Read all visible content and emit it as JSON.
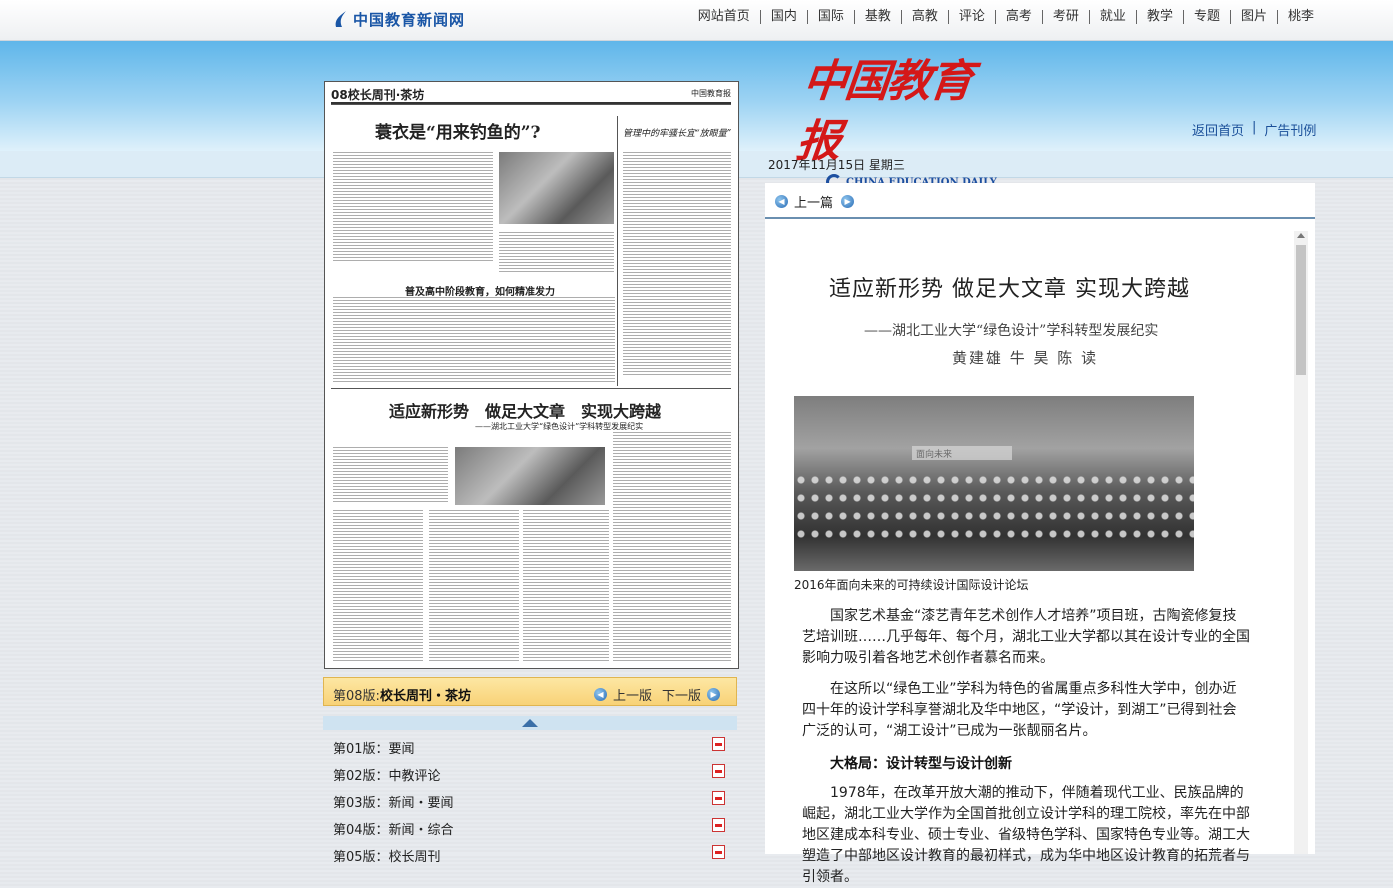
{
  "site": {
    "logo_text": "中国教育新闻网"
  },
  "top_nav": [
    "网站首页",
    "国内",
    "国际",
    "基教",
    "高教",
    "评论",
    "高考",
    "考研",
    "就业",
    "教学",
    "专题",
    "图片",
    "桃李"
  ],
  "masthead": {
    "cn": "中国教育报",
    "en": "CHINA EDUCATION DAILY"
  },
  "links": {
    "home": "返回首页",
    "sep": "|",
    "ads": "广告刊例"
  },
  "date": "2017年11月15日 星期三",
  "paper_page": {
    "header_left": "08校长周刊·茶坊",
    "header_right": "中国教育报",
    "headline_1": "蓑衣是“用来钓鱼的”?",
    "side_headline": "管理中的牢骚长宜“放眼量”",
    "mid_headline": "普及高中阶段教育，如何精准发力",
    "headline_2": "适应新形势　做足大文章　实现大跨越",
    "headline_2_sub": "——湖北工业大学“绿色设计”学科转型发展纪实"
  },
  "edition_bar": {
    "label_prefix": "第08版:",
    "label_name": "校长周刊・茶坊",
    "prev": "上一版",
    "next": "下一版"
  },
  "page_list": [
    {
      "label": "第01版：要闻"
    },
    {
      "label": "第02版：中教评论"
    },
    {
      "label": "第03版：新闻・要闻"
    },
    {
      "label": "第04版：新闻・综合"
    },
    {
      "label": "第05版：校长周刊"
    }
  ],
  "article_nav": {
    "prev": "上一篇"
  },
  "article": {
    "title": "适应新形势  做足大文章  实现大跨越",
    "subtitle": "——湖北工业大学“绿色设计”学科转型发展纪实",
    "authors": "黄建雄 牛 昊 陈 读",
    "photo_banner": "面向未来",
    "caption": "2016年面向未来的可持续设计国际设计论坛",
    "para_1": "国家艺术基金“漆艺青年艺术创作人才培养”项目班，古陶瓷修复技艺培训班……几乎每年、每个月，湖北工业大学都以其在设计专业的全国影响力吸引着各地艺术创作者慕名而来。",
    "para_2": "在这所以“绿色工业”学科为特色的省属重点多科性大学中，创办近四十年的设计学科享誉湖北及华中地区，“学设计，到湖工”已得到社会广泛的认可，“湖工设计”已成为一张靓丽名片。",
    "section_1": "大格局：设计转型与设计创新",
    "para_3": "1978年，在改革开放大潮的推动下，伴随着现代工业、民族品牌的崛起，湖北工业大学作为全国首批创立设计学科的理工院校，率先在中部地区建成本科专业、硕士专业、省级特色学科、国家特色专业等。湖工大塑造了中部地区设计教育的最初样式，成为华中地区设计教育的拓荒者与引领者。"
  },
  "colors": {
    "brand_red": "#d41818",
    "brand_blue": "#1c4fa0",
    "band_blue": "#5fb6ea",
    "edition_bar": "#f8d277"
  }
}
